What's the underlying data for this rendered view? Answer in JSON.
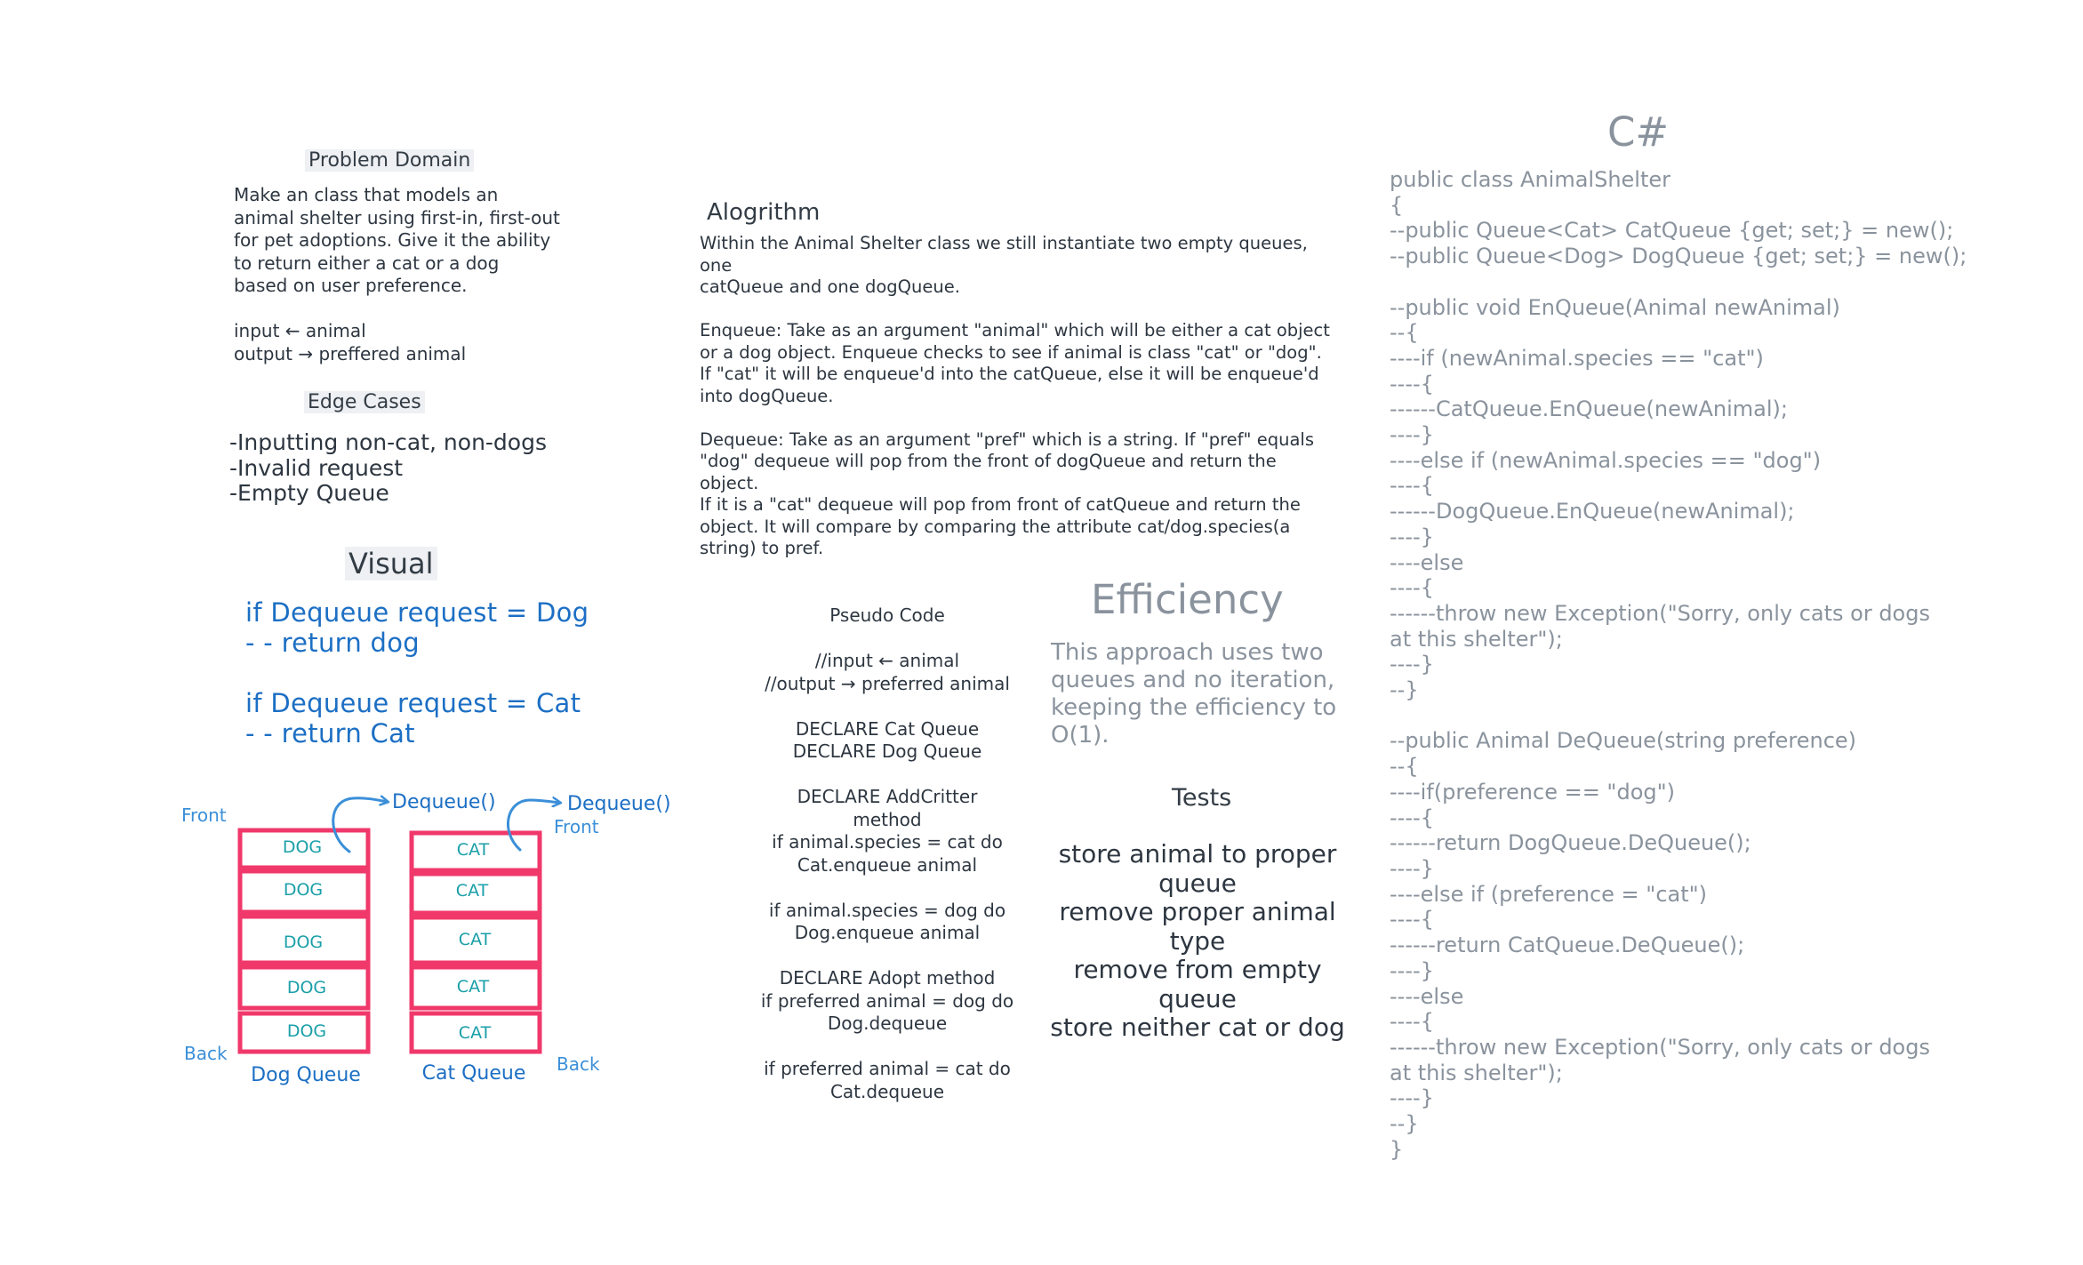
{
  "problem_domain": {
    "title": "Problem Domain",
    "text": "Make an class that models an\nanimal shelter using first-in, first-out\nfor pet adoptions. Give it the ability\nto return either a cat or a dog\nbased on user preference.\n\ninput ← animal\noutput → preffered animal"
  },
  "edge_cases": {
    "title": "Edge Cases",
    "items": "-Inputting non-cat, non-dogs\n-Invalid request\n-Empty Queue"
  },
  "visual": {
    "title": "Visual",
    "text": "if Dequeue request = Dog\n- - return dog\n\nif Dequeue request = Cat\n- - return Cat"
  },
  "algorithm": {
    "title": "Alogrithm",
    "text": "Within the Animal Shelter class we still instantiate two empty queues, one\ncatQueue and one dogQueue.\n\nEnqueue: Take as an argument \"animal\" which will be either a cat object\nor a dog object. Enqueue checks to see if animal is class \"cat\" or \"dog\".\nIf \"cat\" it will be enqueue'd into the catQueue, else it will be enqueue'd\ninto dogQueue.\n\nDequeue: Take as an argument \"pref\" which is a string. If \"pref\" equals\n\"dog\" dequeue will pop from the front of dogQueue and return the object.\nIf it is a \"cat\" dequeue will pop from front of catQueue and return the\nobject. It will compare by comparing the attribute cat/dog.species(a\nstring) to pref."
  },
  "pseudo_code": {
    "text": "Pseudo Code\n\n//input ← animal\n//output → preferred animal\n\nDECLARE Cat Queue\nDECLARE Dog Queue\n\nDECLARE AddCritter\nmethod\nif animal.species = cat do\nCat.enqueue animal\n\nif animal.species = dog do\nDog.enqueue animal\n\nDECLARE Adopt method\nif preferred animal = dog do\nDog.dequeue\n\nif preferred animal = cat do\nCat.dequeue"
  },
  "efficiency": {
    "title": "Efficiency",
    "text": "This approach uses two\nqueues and no iteration,\nkeeping the efficiency to\nO(1)."
  },
  "tests": {
    "title": "Tests",
    "items": "store animal to proper\nqueue\nremove proper animal type\nremove from empty queue\nstore neither cat or dog"
  },
  "csharp": {
    "title": "C#",
    "code": "public class AnimalShelter\n{\n--public Queue<Cat> CatQueue {get; set;} = new();\n--public Queue<Dog> DogQueue {get; set;} = new();\n\n--public void EnQueue(Animal newAnimal)\n--{\n----if (newAnimal.species == \"cat\")\n----{\n------CatQueue.EnQueue(newAnimal);\n----}\n----else if (newAnimal.species == \"dog\")\n----{\n------DogQueue.EnQueue(newAnimal);\n----}\n----else\n----{\n------throw new Exception(\"Sorry, only cats or dogs\nat this shelter\");\n----}\n--}\n\n--public Animal DeQueue(string preference)\n--{\n----if(preference == \"dog\")\n----{\n------return DogQueue.DeQueue();\n----}\n----else if (preference = \"cat\")\n----{\n------return CatQueue.DeQueue();\n----}\n----else\n----{\n------throw new Exception(\"Sorry, only cats or dogs\nat this shelter\");\n----}\n--}\n}"
  },
  "diagram": {
    "dog_queue": {
      "name": "Dog Queue",
      "items": [
        "DOG",
        "DOG",
        "DOG",
        "DOG",
        "DOG"
      ],
      "front_label": "Front",
      "back_label": "Back",
      "dequeue_label": "Dequeue()"
    },
    "cat_queue": {
      "name": "Cat Queue",
      "items": [
        "CAT",
        "CAT",
        "CAT",
        "CAT",
        "CAT"
      ],
      "front_label": "Front",
      "back_label": "Back",
      "dequeue_label": "Dequeue()"
    },
    "colors": {
      "box_border": "#f0386b",
      "item_text": "#1a9fa8",
      "label": "#3b8fd8",
      "queue_name": "#1c6fc4"
    }
  }
}
